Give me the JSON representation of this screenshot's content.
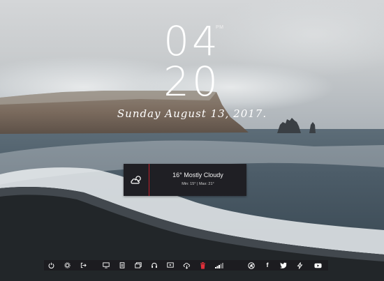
{
  "clock": {
    "hours": "04",
    "minutes": "20",
    "ampm": "PM",
    "date": "Sunday August 13, 2017."
  },
  "weather": {
    "icon": "cloud-sun-icon",
    "summary": "16° Mostly Cloudy",
    "range": "Min: 15° | Max: 21°",
    "accent_color": "#c0202a"
  },
  "taskbar": {
    "icons": [
      "power-icon",
      "settings-icon",
      "logout-icon",
      "monitor-icon",
      "document-icon",
      "gallery-icon",
      "headphones-icon",
      "video-player-icon",
      "cloud-download-icon",
      "trash-icon",
      "signal-icon",
      "chrome-icon",
      "facebook-icon",
      "twitter-icon",
      "bolt-icon",
      "youtube-icon"
    ],
    "facebook_glyph": "f",
    "trash_color": "#e0303a"
  }
}
